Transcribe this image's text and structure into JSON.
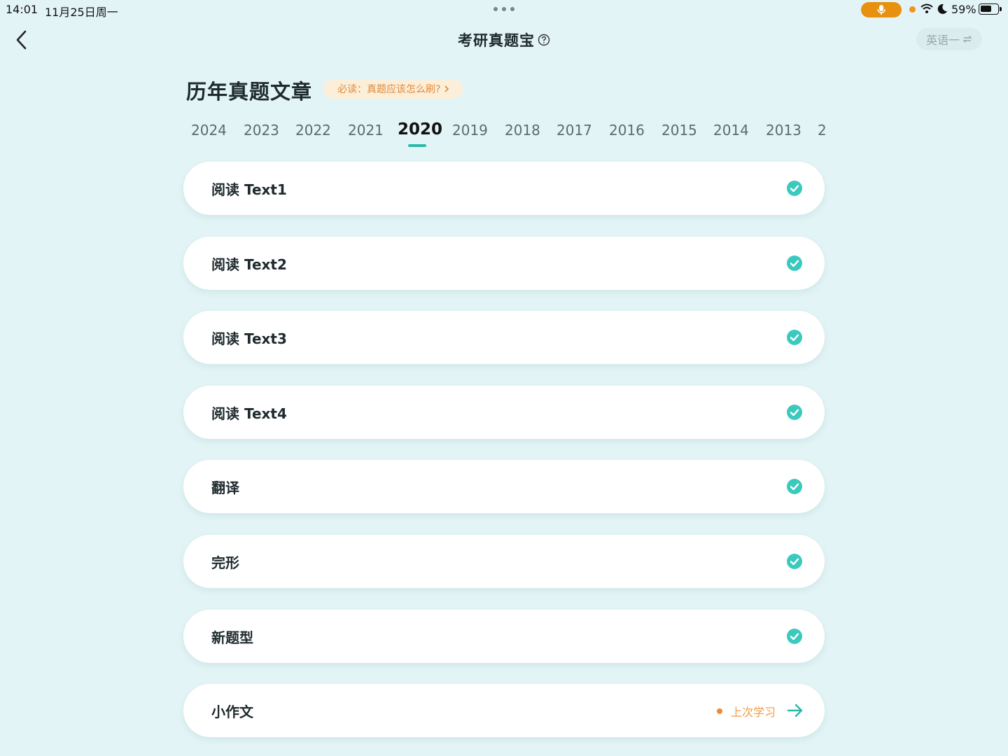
{
  "status_bar": {
    "time": "14:01",
    "date": "11月25日周一",
    "battery": "59%"
  },
  "nav": {
    "title": "考研真题宝",
    "subject_button": "英语一"
  },
  "header": {
    "title": "历年真题文章",
    "tip": "必读：真题应该怎么刷?"
  },
  "years": [
    "2024",
    "2023",
    "2022",
    "2021",
    "2020",
    "2019",
    "2018",
    "2017",
    "2016",
    "2015",
    "2014",
    "2013",
    "2"
  ],
  "selected_year": "2020",
  "items": [
    {
      "label": "阅读 Text1",
      "status": "done"
    },
    {
      "label": "阅读 Text2",
      "status": "done"
    },
    {
      "label": "阅读 Text3",
      "status": "done"
    },
    {
      "label": "阅读 Text4",
      "status": "done"
    },
    {
      "label": "翻译",
      "status": "done"
    },
    {
      "label": "完形",
      "status": "done"
    },
    {
      "label": "新题型",
      "status": "done"
    },
    {
      "label": "小作文",
      "status": "last",
      "last_label": "上次学习"
    }
  ],
  "colors": {
    "background": "#e3f4f6",
    "accent": "#2bb8a8",
    "check": "#3cc9bd",
    "tip_text": "#e0893a",
    "last_study": "#f29a45"
  }
}
